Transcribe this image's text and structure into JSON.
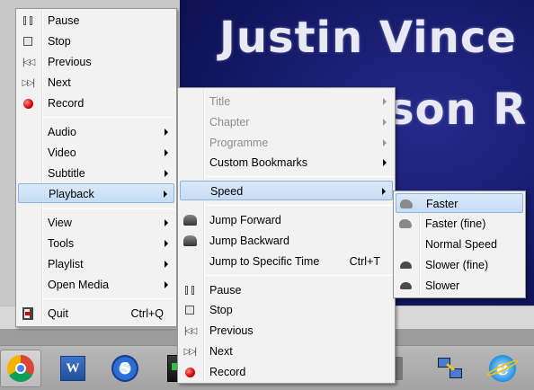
{
  "video": {
    "line1": "Justin Vince",
    "line2": "son R"
  },
  "menus": {
    "main": {
      "items": [
        {
          "label": "Pause",
          "icon": "pause-icon"
        },
        {
          "label": "Stop",
          "icon": "stop-icon"
        },
        {
          "label": "Previous",
          "icon": "previous-icon"
        },
        {
          "label": "Next",
          "icon": "next-icon"
        },
        {
          "label": "Record",
          "icon": "record-icon"
        },
        {
          "label": "Audio"
        },
        {
          "label": "Video"
        },
        {
          "label": "Subtitle"
        },
        {
          "label": "Playback"
        },
        {
          "label": "View"
        },
        {
          "label": "Tools"
        },
        {
          "label": "Playlist"
        },
        {
          "label": "Open Media"
        },
        {
          "label": "Quit",
          "shortcut": "Ctrl+Q",
          "icon": "quit-icon"
        }
      ]
    },
    "playback": {
      "items": [
        {
          "label": "Title"
        },
        {
          "label": "Chapter"
        },
        {
          "label": "Programme"
        },
        {
          "label": "Custom Bookmarks"
        },
        {
          "label": "Speed"
        },
        {
          "label": "Jump Forward",
          "icon": "jump-forward-icon"
        },
        {
          "label": "Jump Backward",
          "icon": "jump-backward-icon"
        },
        {
          "label": "Jump to Specific Time",
          "shortcut": "Ctrl+T"
        },
        {
          "label": "Pause",
          "icon": "pause-icon"
        },
        {
          "label": "Stop",
          "icon": "stop-icon"
        },
        {
          "label": "Previous",
          "icon": "previous-icon"
        },
        {
          "label": "Next",
          "icon": "next-icon"
        },
        {
          "label": "Record",
          "icon": "record-icon"
        }
      ]
    },
    "speed": {
      "items": [
        {
          "label": "Faster",
          "icon": "rabbit-icon"
        },
        {
          "label": "Faster (fine)",
          "icon": "rabbit-icon"
        },
        {
          "label": "Normal Speed"
        },
        {
          "label": "Slower (fine)",
          "icon": "turtle-icon"
        },
        {
          "label": "Slower",
          "icon": "turtle-icon"
        }
      ]
    }
  },
  "taskbar": {
    "apps": [
      {
        "name": "Chrome",
        "icon": "chrome-icon"
      },
      {
        "name": "Word",
        "icon": "word-icon"
      },
      {
        "name": "Update utility",
        "icon": "sync-icon"
      },
      {
        "name": "App",
        "icon": "app-icon"
      },
      {
        "name": "Remote desktop",
        "icon": "network-icon"
      },
      {
        "name": "Internet Explorer",
        "icon": "ie-icon"
      }
    ]
  },
  "colors": {
    "highlight": "#c5dcf6",
    "video_bg": "#141866",
    "record": "#d10000"
  }
}
